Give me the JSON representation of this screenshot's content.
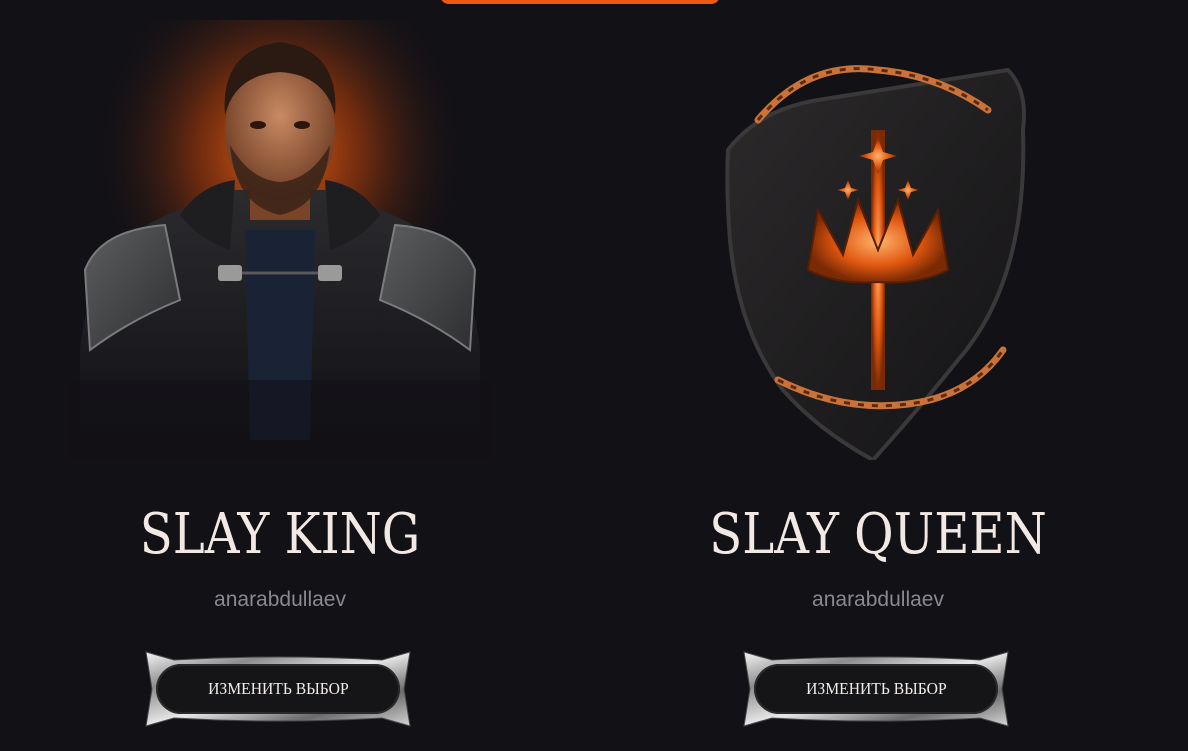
{
  "cards": [
    {
      "title": "SLAY KING",
      "username": "anarabdullaev",
      "button_label": "ИЗМЕНИТЬ ВЫБОР",
      "image": "king-portrait-icon"
    },
    {
      "title": "SLAY QUEEN",
      "username": "anarabdullaev",
      "button_label": "ИЗМЕНИТЬ ВЫБОР",
      "image": "crowned-shield-icon"
    }
  ],
  "colors": {
    "background": "#121116",
    "accent": "#ee5a12",
    "title": "#f2e9e4",
    "subtitle": "#8a8990"
  }
}
